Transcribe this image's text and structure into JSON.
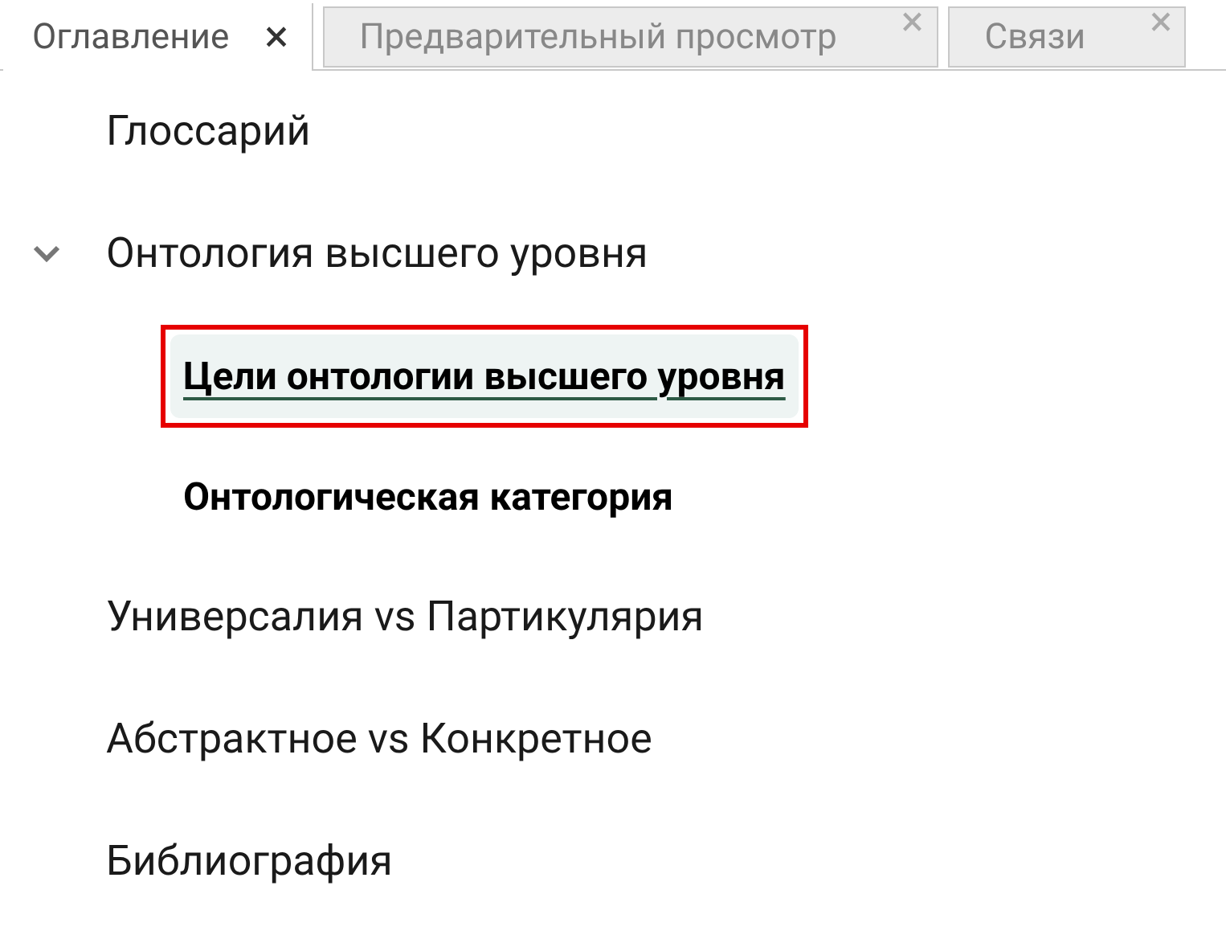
{
  "tabs": [
    {
      "label": "Оглавление",
      "close": "×",
      "selected": true
    },
    {
      "label": "Предварительный просмотр",
      "close": "×",
      "selected": false
    },
    {
      "label": "Связи",
      "close": "×",
      "selected": false
    }
  ],
  "toc": {
    "items": [
      {
        "label": "Глоссарий"
      },
      {
        "label": "Онтология высшего уровня",
        "expanded": true,
        "children": [
          {
            "label": "Цели онтологии высшего уровня",
            "selected": true
          },
          {
            "label": "Онтологическая категория",
            "selected": false
          }
        ]
      },
      {
        "label": "Универсалия vs Партикулярия"
      },
      {
        "label": "Абстрактное vs Конкретное"
      },
      {
        "label": "Библиография"
      }
    ]
  }
}
